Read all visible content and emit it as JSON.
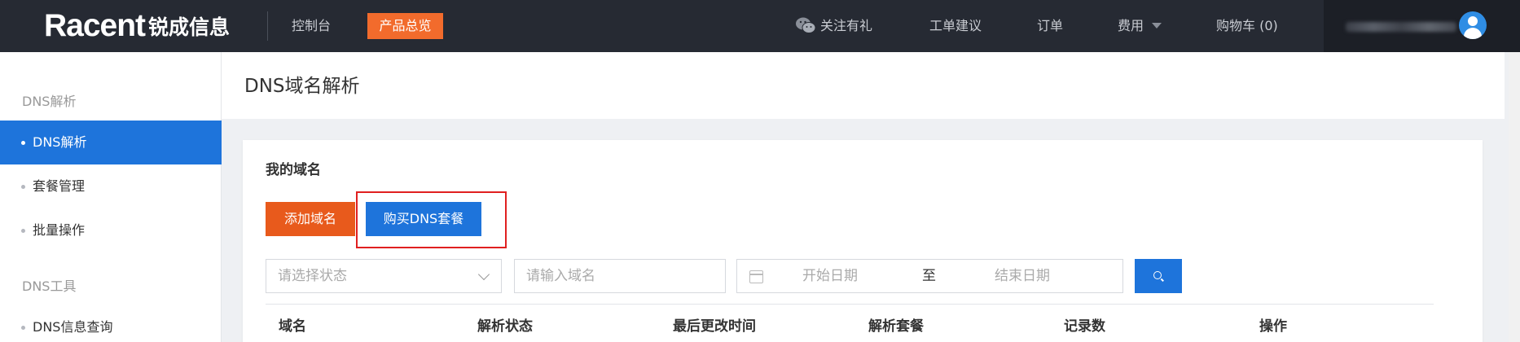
{
  "header": {
    "logo_main": "Racent",
    "logo_cn": "锐成信息",
    "console_link": "控制台",
    "products_button": "产品总览",
    "follow_label": "关注有礼",
    "ticket_label": "工单建议",
    "orders_label": "订单",
    "fees_label": "费用",
    "cart_label": "购物车 (0)"
  },
  "sidebar": {
    "groups": [
      {
        "title": "DNS解析",
        "items": [
          "DNS解析",
          "套餐管理",
          "批量操作"
        ]
      },
      {
        "title": "DNS工具",
        "items": [
          "DNS信息查询"
        ]
      }
    ],
    "active_item": "DNS解析"
  },
  "page": {
    "title": "DNS域名解析"
  },
  "card": {
    "title": "我的域名",
    "add_domain_button": "添加域名",
    "buy_dns_button": "购买DNS套餐",
    "status_select_placeholder": "请选择状态",
    "domain_input_placeholder": "请输入域名",
    "date_start_placeholder": "开始日期",
    "date_separator": "至",
    "date_end_placeholder": "结束日期"
  },
  "table": {
    "columns": [
      "域名",
      "解析状态",
      "最后更改时间",
      "解析套餐",
      "记录数",
      "操作"
    ]
  },
  "colors": {
    "topbar": "#262a33",
    "accent_orange": "#f26b2c",
    "primary_blue": "#1e74db",
    "highlight_red": "#e02020"
  }
}
